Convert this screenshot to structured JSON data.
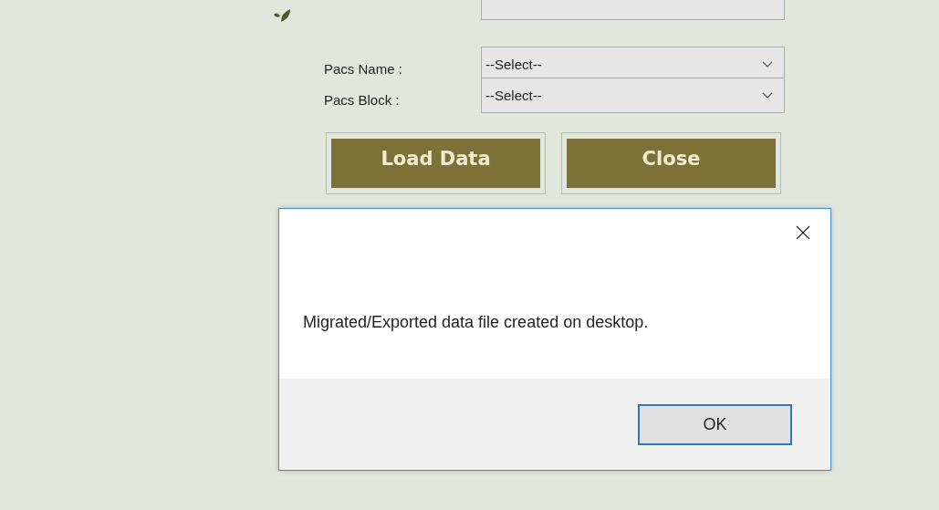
{
  "form": {
    "fields": [
      {
        "label": "Pacs Name :",
        "value": "--Select--"
      },
      {
        "label": "Pacs Block :",
        "value": "--Select--"
      }
    ],
    "buttons": [
      "Load Data",
      "Close"
    ]
  },
  "dialog": {
    "message": "Migrated/Exported data file created on desktop.",
    "button": "OK"
  }
}
